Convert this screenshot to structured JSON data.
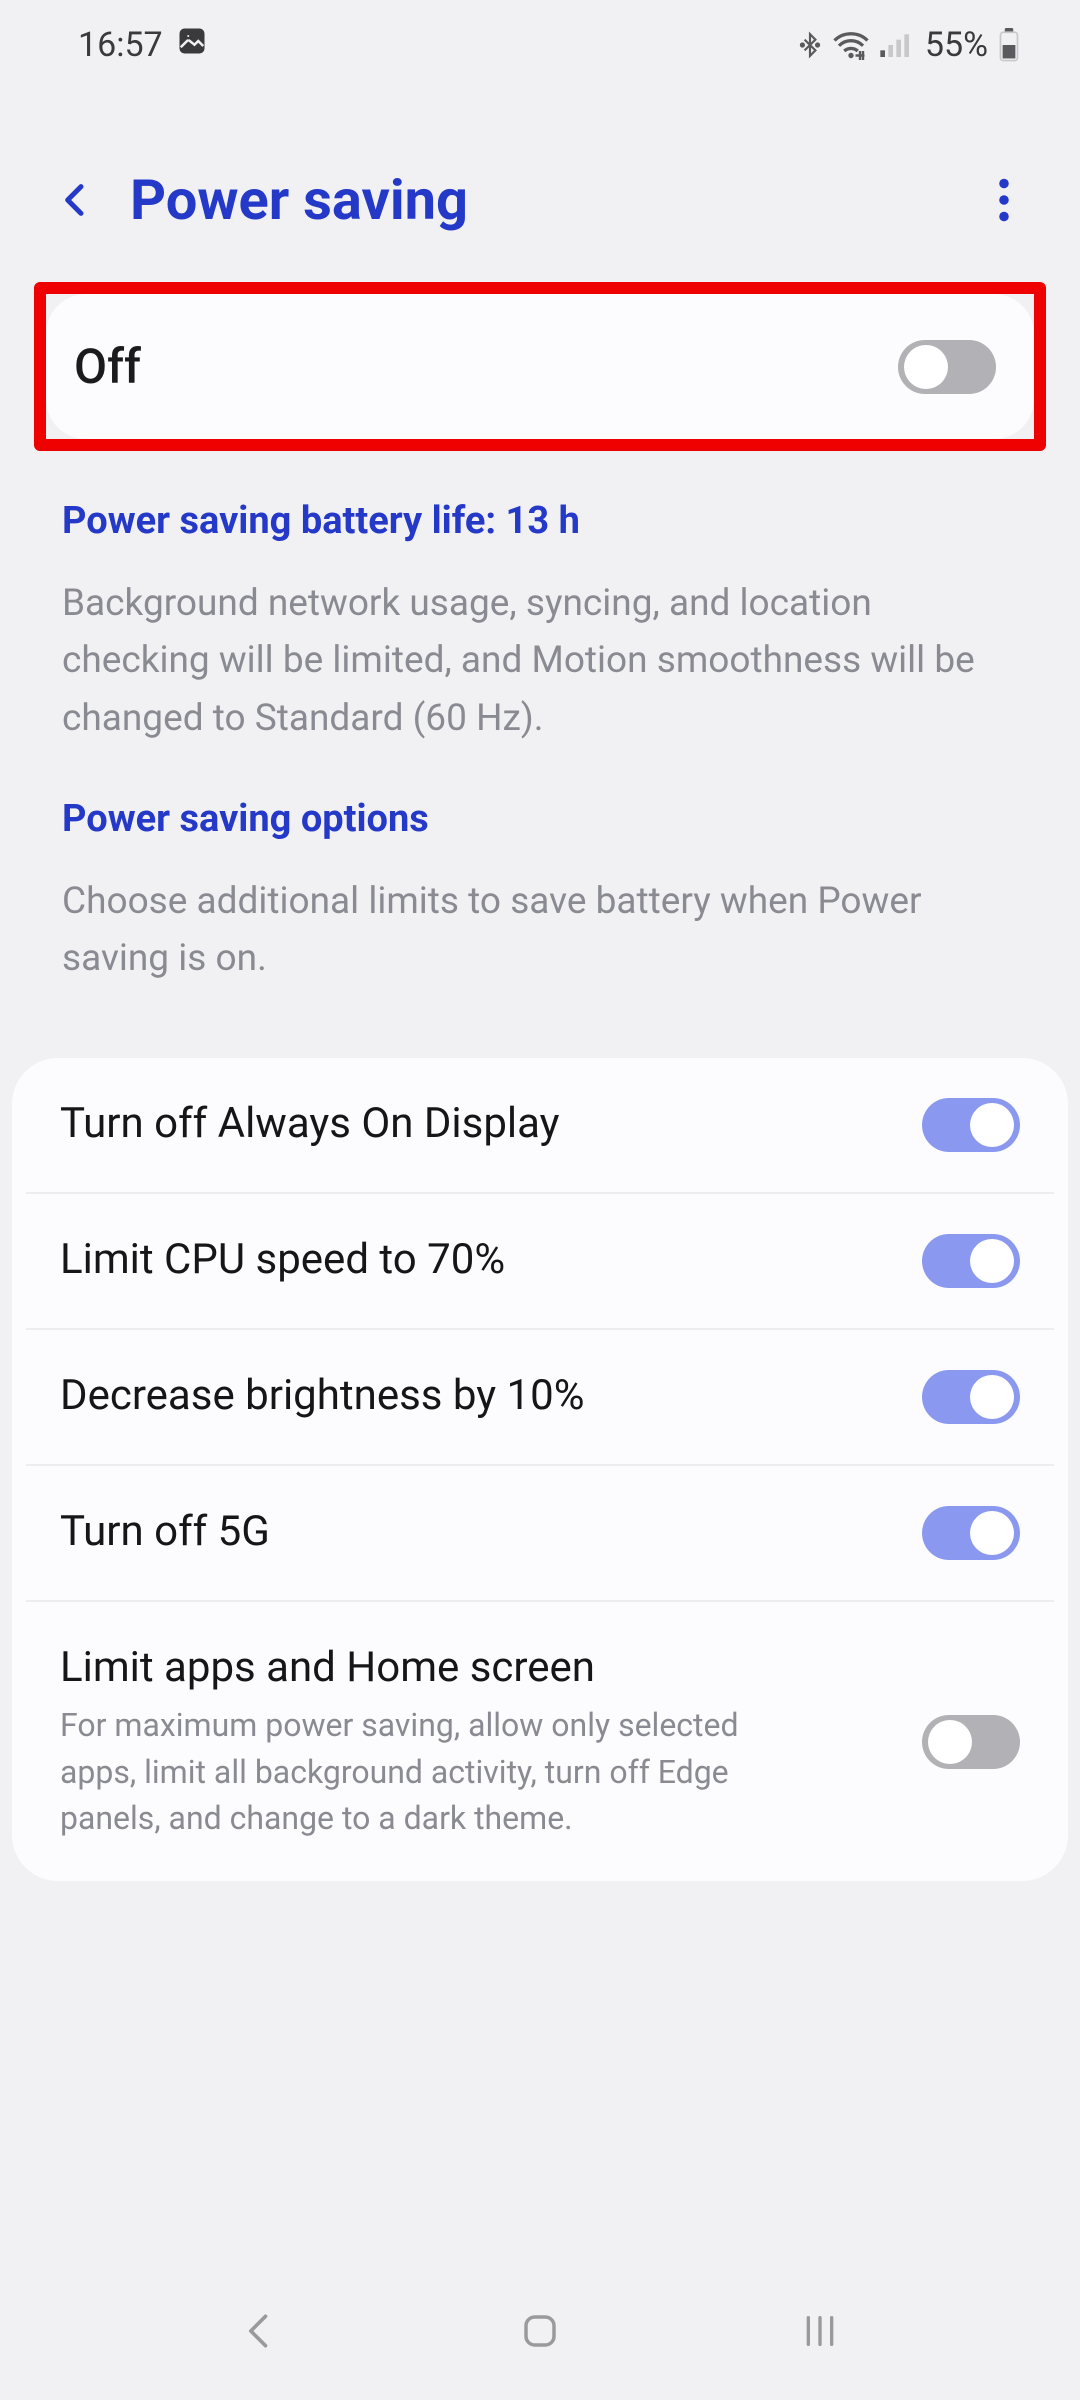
{
  "status": {
    "time": "16:57",
    "battery_text": "55%"
  },
  "header": {
    "title": "Power saving"
  },
  "master": {
    "label": "Off",
    "on": false
  },
  "info1": {
    "heading": "Power saving battery life: 13 h",
    "body": "Background network usage, syncing, and location checking will be limited, and Motion smoothness will be changed to Standard (60 Hz)."
  },
  "info2": {
    "heading": "Power saving options",
    "body": "Choose additional limits to save battery when Power saving is on."
  },
  "options": [
    {
      "title": "Turn off Always On Display",
      "sub": "",
      "on": true
    },
    {
      "title": "Limit CPU speed to 70%",
      "sub": "",
      "on": true
    },
    {
      "title": "Decrease brightness by 10%",
      "sub": "",
      "on": true
    },
    {
      "title": "Turn off 5G",
      "sub": "",
      "on": true
    },
    {
      "title": "Limit apps and Home screen",
      "sub": "For maximum power saving, allow only selected apps, limit all background activity, turn off Edge panels, and change to a dark theme.",
      "on": false
    }
  ]
}
